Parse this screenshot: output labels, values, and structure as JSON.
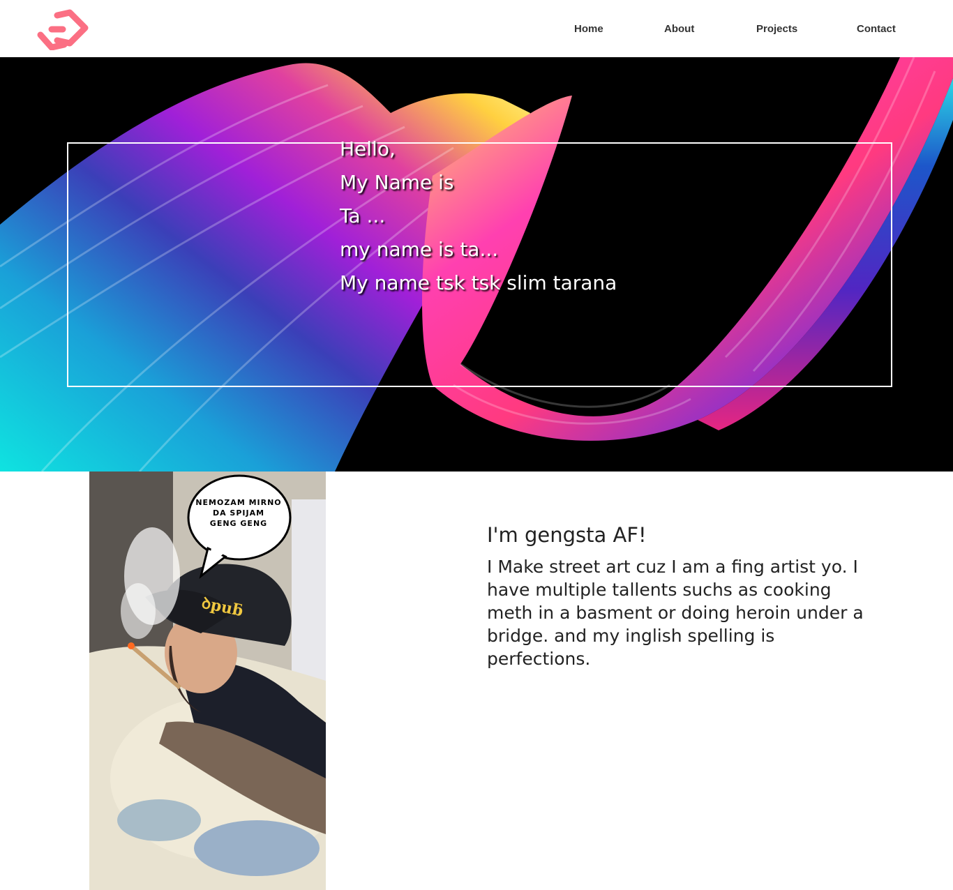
{
  "header": {
    "logo": {
      "icon": "diamond-logo-icon",
      "color": "#fb6f83"
    },
    "nav": [
      "Home",
      "About",
      "Projects",
      "Contact"
    ]
  },
  "hero": {
    "lines": [
      "Hello,",
      "My Name is",
      "Ta ...",
      "my name is ta...",
      "My name tsk tsk slim tarana"
    ]
  },
  "about": {
    "photo_bubble_text": [
      "NEMOZAM MIRNO",
      "DA SPIJAM",
      "GENG GENG"
    ],
    "title": "I'm gengsta AF!",
    "text": "I Make street art cuz I am a fing artist yo. I have multiple tallents suchs as cooking meth in a basment or doing heroin under a bridge. and my inglish spelling is perfections."
  }
}
